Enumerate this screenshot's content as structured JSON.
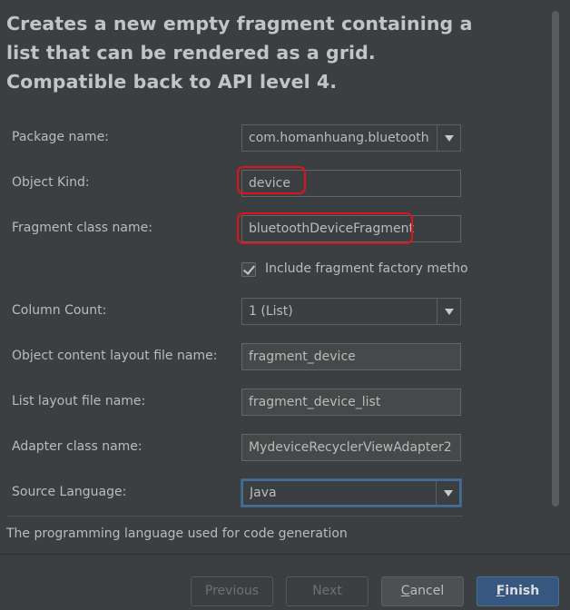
{
  "description": "Creates a new empty fragment containing a list that can be rendered as a grid. Compatible back to API level 4.",
  "form": {
    "package_name": {
      "label": "Package name:",
      "value": "com.homanhuang.bluetoothlec"
    },
    "object_kind": {
      "label": "Object Kind:",
      "value": "device"
    },
    "fragment_class_name": {
      "label": "Fragment class name:",
      "value": "bluetoothDeviceFragment"
    },
    "include_factory": {
      "label": "Include fragment factory metho...",
      "checked": true
    },
    "column_count": {
      "label": "Column Count:",
      "value": "1 (List)"
    },
    "object_content_layout": {
      "label": "Object content layout file name:",
      "value": "fragment_device"
    },
    "list_layout": {
      "label": "List layout file name:",
      "value": "fragment_device_list"
    },
    "adapter_class_name": {
      "label": "Adapter class name:",
      "value": "MydeviceRecyclerViewAdapter2"
    },
    "source_language": {
      "label": "Source Language:",
      "value": "Java"
    }
  },
  "help_text": "The programming language used for code generation",
  "buttons": {
    "previous": "Previous",
    "next": "Next",
    "cancel_first": "C",
    "cancel_rest": "ancel",
    "finish_first": "F",
    "finish_rest": "inish"
  },
  "colors": {
    "background": "#3c3f41",
    "primary_button": "#365880",
    "highlight_marker": "#e0121c",
    "focus_border": "#466d94"
  }
}
